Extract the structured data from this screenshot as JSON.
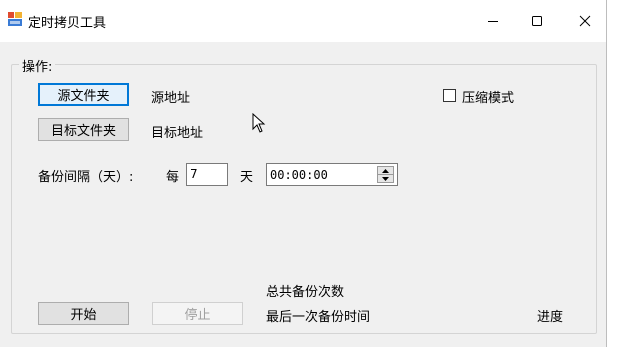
{
  "window": {
    "title": "定时拷贝工具",
    "icon": "app-icon",
    "controls": {
      "minimize": "minimize-icon",
      "maximize": "maximize-icon",
      "close": "close-icon"
    }
  },
  "group": {
    "label": "操作:"
  },
  "source": {
    "button_label": "源文件夹",
    "address_label": "源地址"
  },
  "target": {
    "button_label": "目标文件夹",
    "address_label": "目标地址"
  },
  "compress": {
    "label": "压缩模式",
    "checked": false
  },
  "interval": {
    "label": "备份间隔（天）:",
    "every_label": "每",
    "days_value": "7",
    "day_unit": "天",
    "time_value": "00:00:00"
  },
  "status": {
    "total_backups_label": "总共备份次数",
    "last_backup_label": "最后一次备份时间",
    "progress_label": "进度"
  },
  "actions": {
    "start_label": "开始",
    "stop_label": "停止"
  },
  "colors": {
    "focus": "#0078d7",
    "window_bg": "#f0f0f0",
    "titlebar_bg": "#ffffff"
  }
}
